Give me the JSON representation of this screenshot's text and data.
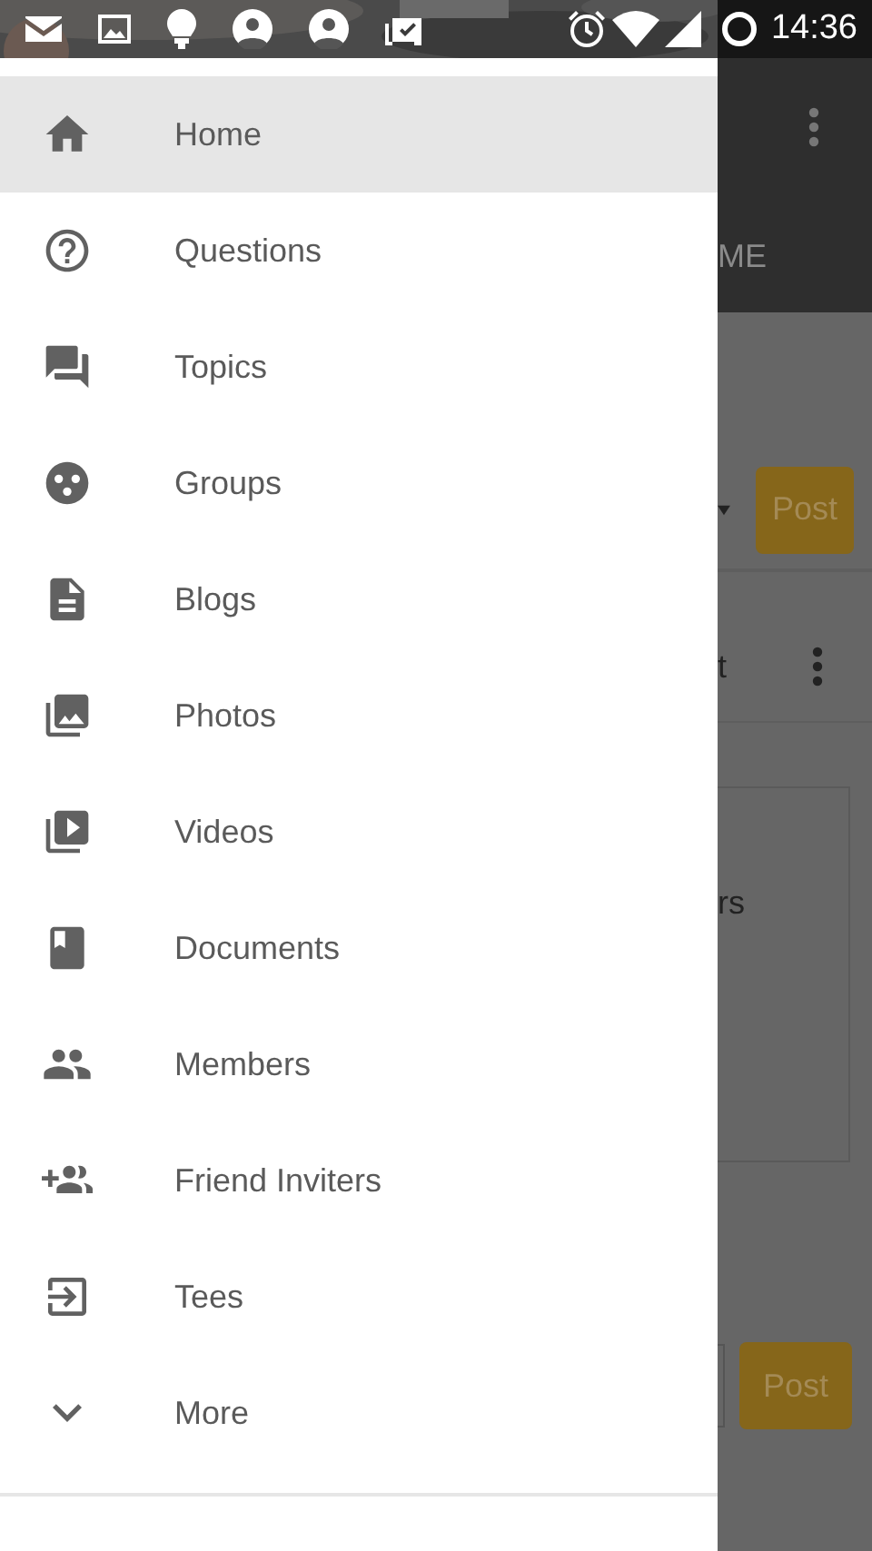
{
  "status_bar": {
    "time": "14:36"
  },
  "drawer": {
    "items": [
      {
        "label": "Home",
        "selected": true
      },
      {
        "label": "Questions",
        "selected": false
      },
      {
        "label": "Topics",
        "selected": false
      },
      {
        "label": "Groups",
        "selected": false
      },
      {
        "label": "Blogs",
        "selected": false
      },
      {
        "label": "Photos",
        "selected": false
      },
      {
        "label": "Videos",
        "selected": false
      },
      {
        "label": "Documents",
        "selected": false
      },
      {
        "label": "Members",
        "selected": false
      },
      {
        "label": "Friend Inviters",
        "selected": false
      },
      {
        "label": "Tees",
        "selected": false
      },
      {
        "label": "More",
        "selected": false
      }
    ]
  },
  "background": {
    "tab": "ME",
    "composer_button": "Post",
    "card_title": "t",
    "card_body": "rs",
    "reply_button": "Post"
  }
}
